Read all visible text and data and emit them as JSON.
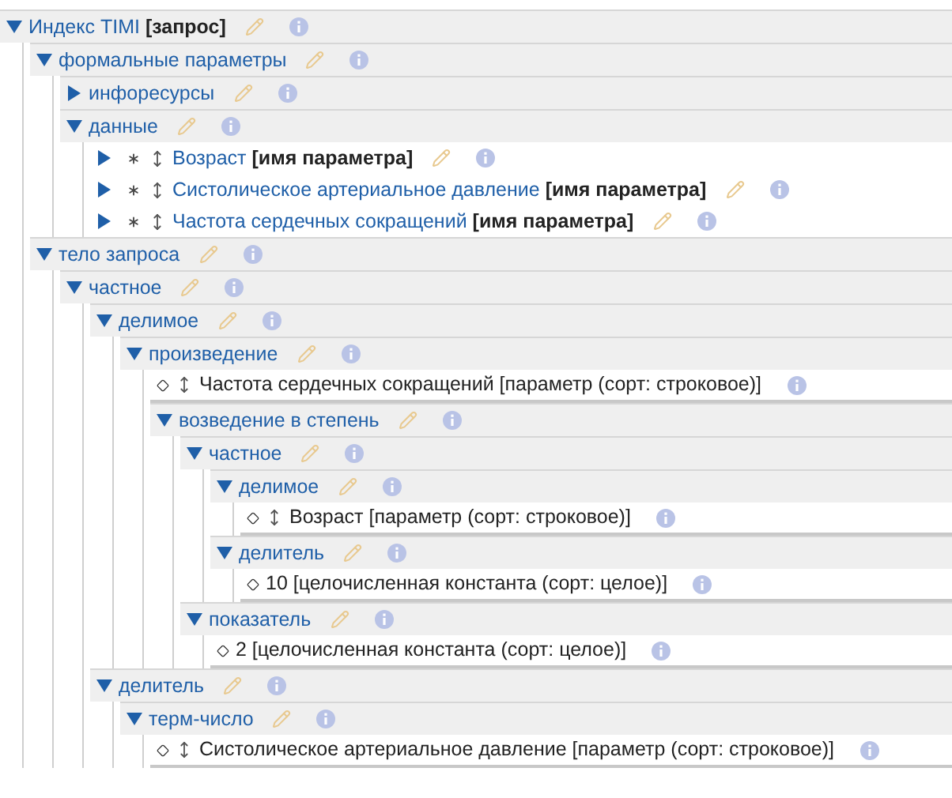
{
  "tree": [
    {
      "kind": "concept",
      "name": "Индекс TIMI",
      "type": "[запрос]",
      "expanded": true,
      "children": [
        {
          "kind": "concept",
          "name": "формальные параметры",
          "expanded": true,
          "children": [
            {
              "kind": "concept",
              "name": "инфоресурсы",
              "expanded": false
            },
            {
              "kind": "concept",
              "name": "данные",
              "expanded": true,
              "children": [
                {
                  "kind": "param",
                  "name": "Возраст",
                  "type": "[имя параметра]",
                  "expanded": false
                },
                {
                  "kind": "param",
                  "name": "Систолическое артериальное давление",
                  "type": "[имя параметра]",
                  "expanded": false
                },
                {
                  "kind": "param",
                  "name": "Частота сердечных сокращений",
                  "type": "[имя параметра]",
                  "expanded": false
                }
              ]
            }
          ]
        },
        {
          "kind": "concept",
          "name": "тело запроса",
          "expanded": true,
          "children": [
            {
              "kind": "concept",
              "name": "частное",
              "expanded": true,
              "children": [
                {
                  "kind": "concept",
                  "name": "делимое",
                  "expanded": true,
                  "children": [
                    {
                      "kind": "concept",
                      "name": "произведение",
                      "expanded": true,
                      "children": [
                        {
                          "kind": "leaf",
                          "text": "Частота сердечных сокращений [параметр (сорт: строковое)]",
                          "movable": true
                        },
                        {
                          "kind": "concept",
                          "name": "возведение в степень",
                          "expanded": true,
                          "children": [
                            {
                              "kind": "concept",
                              "name": "частное",
                              "expanded": true,
                              "children": [
                                {
                                  "kind": "concept",
                                  "name": "делимое",
                                  "expanded": true,
                                  "children": [
                                    {
                                      "kind": "leaf",
                                      "text": "Возраст [параметр (сорт: строковое)]",
                                      "movable": true
                                    }
                                  ]
                                },
                                {
                                  "kind": "concept",
                                  "name": "делитель",
                                  "expanded": true,
                                  "children": [
                                    {
                                      "kind": "leaf",
                                      "text": "10 [целочисленная константа (сорт: целое)]",
                                      "movable": false
                                    }
                                  ]
                                }
                              ]
                            },
                            {
                              "kind": "concept",
                              "name": "показатель",
                              "expanded": true,
                              "children": [
                                {
                                  "kind": "leaf",
                                  "text": "2 [целочисленная константа (сорт: целое)]",
                                  "movable": false
                                }
                              ]
                            }
                          ]
                        }
                      ]
                    }
                  ]
                },
                {
                  "kind": "concept",
                  "name": "делитель",
                  "expanded": true,
                  "children": [
                    {
                      "kind": "concept",
                      "name": "терм-число",
                      "expanded": true,
                      "children": [
                        {
                          "kind": "leaf",
                          "text": "Систолическое артериальное давление [параметр (сорт: строковое)]",
                          "movable": true
                        }
                      ]
                    }
                  ]
                }
              ]
            }
          ]
        }
      ]
    }
  ]
}
